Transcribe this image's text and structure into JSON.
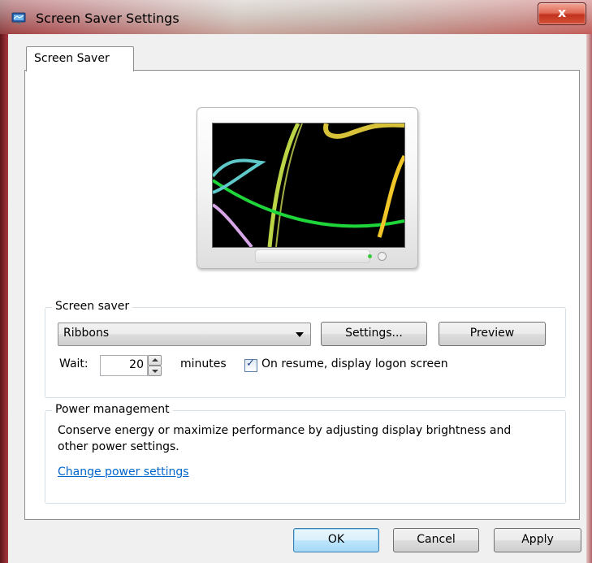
{
  "window": {
    "title": "Screen Saver Settings",
    "close_label": "x"
  },
  "tab": {
    "label": "Screen Saver"
  },
  "screen_saver": {
    "legend": "Screen saver",
    "selected": "Ribbons",
    "settings_label": "Settings...",
    "preview_label": "Preview",
    "wait_label": "Wait:",
    "wait_value": "20",
    "minutes_label": "minutes",
    "resume_checked": true,
    "resume_label": "On resume, display logon screen"
  },
  "power": {
    "legend": "Power management",
    "description": "Conserve energy or maximize performance by adjusting display brightness and other power settings.",
    "link_label": "Change power settings"
  },
  "buttons": {
    "ok": "OK",
    "cancel": "Cancel",
    "apply": "Apply"
  }
}
